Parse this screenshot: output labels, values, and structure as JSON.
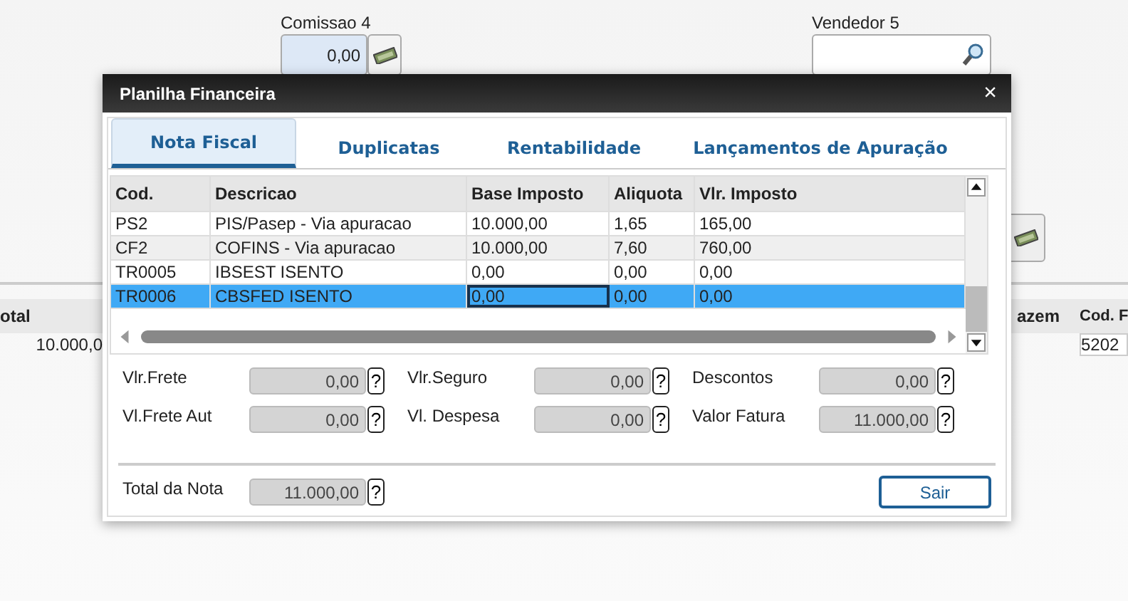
{
  "background": {
    "fields": [
      {
        "label": "Comissao 4",
        "value": "0,00",
        "kind": "money",
        "focused": true
      },
      {
        "label": "Vendedor 5",
        "kind": "search",
        "focused": false
      }
    ],
    "table": {
      "columns": [
        "otal",
        "azem",
        "Cod. F"
      ],
      "cells": [
        "10.000,0",
        "5202"
      ]
    }
  },
  "dialog": {
    "title": "Planilha Financeira",
    "close": "×",
    "tabs": [
      {
        "label": "Nota Fiscal",
        "selected": true
      },
      {
        "label": "Duplicatas",
        "selected": false
      },
      {
        "label": "Rentabilidade",
        "selected": false
      },
      {
        "label": "Lançamentos de Apuração",
        "selected": false
      }
    ],
    "table": {
      "columns": [
        "Cod.",
        "Descricao",
        "Base Imposto",
        "Aliquota",
        "Vlr. Imposto"
      ],
      "rows": [
        {
          "cells": [
            "PS2",
            "PIS/Pasep - Via apuracao",
            "10.000,00",
            "1,65",
            "165,00"
          ],
          "selected": false,
          "base_focused": false
        },
        {
          "cells": [
            "CF2",
            "COFINS - Via apuracao",
            "10.000,00",
            "7,60",
            "760,00"
          ],
          "selected": false,
          "base_focused": false
        },
        {
          "cells": [
            "TR0005",
            "IBSEST ISENTO",
            "0,00",
            "0,00",
            "0,00"
          ],
          "selected": false,
          "base_focused": false
        },
        {
          "cells": [
            "TR0006",
            "CBSFED ISENTO",
            "0,00",
            "0,00",
            "0,00"
          ],
          "selected": true,
          "base_focused": true
        }
      ]
    },
    "fields": [
      {
        "label": "Vlr.Frete",
        "value": "0,00",
        "help": "?"
      },
      {
        "label": "Vlr.Seguro",
        "value": "0,00",
        "help": "?"
      },
      {
        "label": "Descontos",
        "value": "0,00",
        "help": "?"
      },
      {
        "label": "Vl.Frete Aut",
        "value": "0,00",
        "help": "?"
      },
      {
        "label": "Vl. Despesa",
        "value": "0,00",
        "help": "?"
      },
      {
        "label": "Valor Fatura",
        "value": "11.000,00",
        "help": "?"
      }
    ],
    "total": {
      "label": "Total da Nota",
      "value": "11.000,00",
      "help": "?"
    },
    "buttons": [
      "Sair"
    ]
  }
}
